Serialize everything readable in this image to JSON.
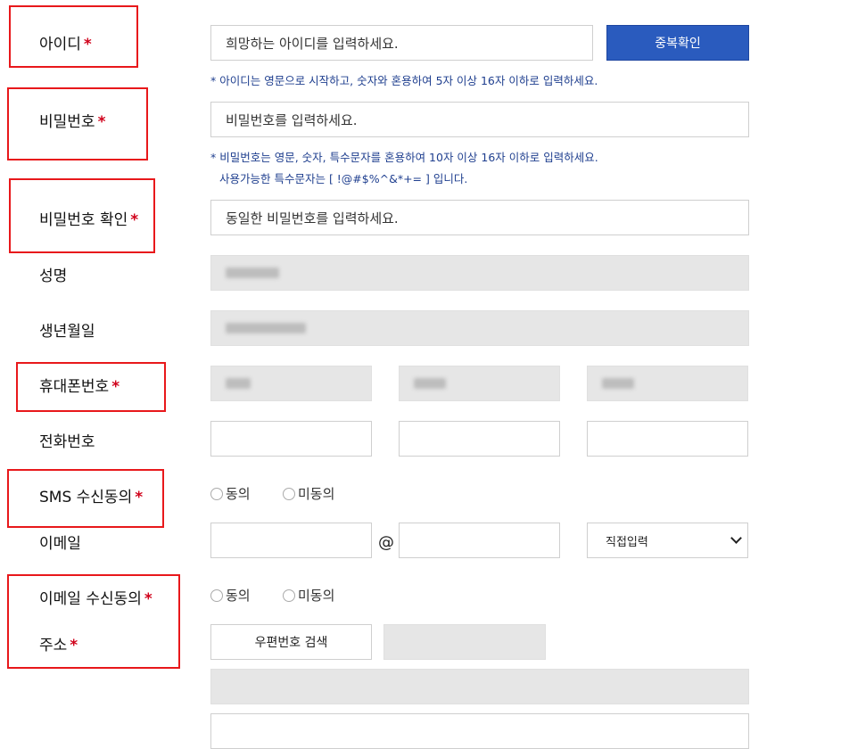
{
  "form": {
    "required_mark": "*",
    "userid": {
      "label": "아이디",
      "placeholder": "희망하는 아이디를 입력하세요.",
      "check_button": "중복확인",
      "hint": "* 아이디는 영문으로 시작하고, 숫자와 혼용하여 5자 이상 16자 이하로 입력하세요."
    },
    "password": {
      "label": "비밀번호",
      "placeholder": "비밀번호를 입력하세요.",
      "hint_line1": "* 비밀번호는 영문, 숫자, 특수문자를 혼용하여 10자 이상 16자 이하로 입력하세요.",
      "hint_line2": "사용가능한 특수문자는 [ !@#$%^&*+= ] 입니다."
    },
    "password_confirm": {
      "label": "비밀번호 확인",
      "placeholder": "동일한 비밀번호를 입력하세요."
    },
    "name": {
      "label": "성명"
    },
    "birth": {
      "label": "생년월일"
    },
    "mobile": {
      "label": "휴대폰번호"
    },
    "phone": {
      "label": "전화번호"
    },
    "sms_consent": {
      "label": "SMS 수신동의",
      "agree": "동의",
      "disagree": "미동의"
    },
    "email": {
      "label": "이메일",
      "at": "@",
      "domain_select": "직접입력"
    },
    "email_consent": {
      "label": "이메일 수신동의",
      "agree": "동의",
      "disagree": "미동의"
    },
    "address": {
      "label": "주소",
      "search_button": "우편번호 검색"
    }
  },
  "colors": {
    "accent": "#2a5bbe",
    "required": "#d0021b",
    "highlight_box": "#e8181b",
    "hint": "#1f3f8f"
  }
}
